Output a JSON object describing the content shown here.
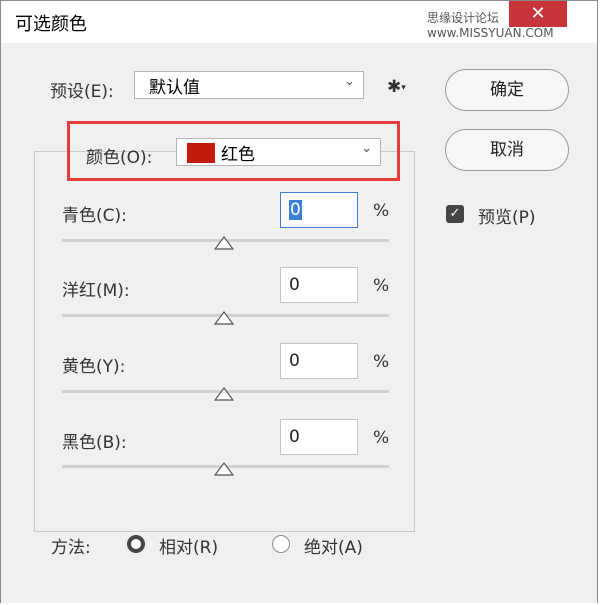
{
  "window": {
    "title": "可选颜色",
    "watermark": "思缘设计论坛 www.MISSYUAN.COM"
  },
  "close_glyph": "✕",
  "preset": {
    "label": "预设(E):",
    "value": "默认值"
  },
  "gear_glyph": "✱",
  "buttons": {
    "ok": "确定",
    "cancel": "取消"
  },
  "colors": {
    "label": "颜色(O):",
    "value": "红色",
    "swatch_color": "#c21a0c"
  },
  "sliders": [
    {
      "label": "青色(C):",
      "value": "0",
      "unit": "%"
    },
    {
      "label": "洋红(M):",
      "value": "0",
      "unit": "%"
    },
    {
      "label": "黄色(Y):",
      "value": "0",
      "unit": "%"
    },
    {
      "label": "黑色(B):",
      "value": "0",
      "unit": "%"
    }
  ],
  "preview": {
    "label": "预览(P)",
    "checked": true
  },
  "method": {
    "label": "方法:",
    "options": [
      {
        "label": "相对(R)",
        "selected": true
      },
      {
        "label": "绝对(A)",
        "selected": false
      }
    ]
  },
  "accent_color": "#e43b3b"
}
